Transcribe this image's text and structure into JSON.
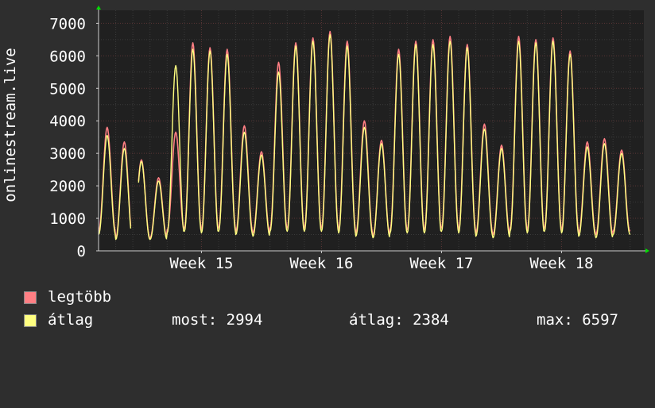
{
  "chart_data": {
    "type": "line",
    "ylabel": "onlinestream.live",
    "ylim": [
      0,
      7400
    ],
    "yticks": [
      0,
      1000,
      2000,
      3000,
      4000,
      5000,
      6000,
      7000
    ],
    "x_unit": "days",
    "xlim": [
      0,
      31.8
    ],
    "xticks": [
      {
        "label": "Week 15",
        "x": 6
      },
      {
        "label": "Week 16",
        "x": 13
      },
      {
        "label": "Week 17",
        "x": 20
      },
      {
        "label": "Week 18",
        "x": 27
      }
    ],
    "series": [
      {
        "name": "legtöbb",
        "color": "#ff7f84",
        "daily_peaks": [
          3800,
          3350,
          2800,
          2250,
          3650,
          6400,
          6250,
          6200,
          3850,
          3050,
          5800,
          6400,
          6550,
          6750,
          6450,
          4000,
          3400,
          6200,
          6450,
          6500,
          6600,
          6350,
          3900,
          3250,
          6600,
          6500,
          6550,
          6150,
          3350,
          3450,
          3100
        ],
        "daily_lows": [
          600,
          400,
          400,
          400,
          650,
          700,
          650,
          700,
          600,
          550,
          700,
          700,
          700,
          700,
          650,
          550,
          450,
          650,
          650,
          650,
          700,
          650,
          550,
          500,
          700,
          650,
          700,
          650,
          550,
          500,
          600
        ]
      },
      {
        "name": "átlag",
        "color": "#ffff80",
        "daily_peaks": [
          3550,
          3150,
          2750,
          2150,
          5700,
          6200,
          6150,
          6050,
          3650,
          2950,
          5500,
          6300,
          6450,
          6650,
          6300,
          3800,
          3300,
          6050,
          6350,
          6350,
          6450,
          6250,
          3750,
          3150,
          6450,
          6400,
          6450,
          6050,
          3200,
          3300,
          3000
        ],
        "daily_lows": [
          500,
          350,
          350,
          350,
          550,
          600,
          550,
          600,
          500,
          450,
          600,
          600,
          600,
          600,
          550,
          450,
          400,
          550,
          550,
          550,
          600,
          550,
          450,
          400,
          600,
          550,
          600,
          550,
          450,
          400,
          500
        ]
      }
    ],
    "gaps": [
      [
        1.9,
        2.3
      ]
    ],
    "grid": true,
    "legend_position": "bottom-left"
  },
  "legend": {
    "items": [
      {
        "label": "legtöbb",
        "color": "#ff7f84"
      },
      {
        "label": "átlag",
        "color": "#ffff80"
      }
    ],
    "stats": {
      "current": "most: 2994",
      "average": "átlag: 2384",
      "max": "max: 6597"
    }
  },
  "colors": {
    "background": "#2e2e2e",
    "plot_background": "#202020",
    "grid_minor": "#3a3a3a",
    "grid_major": "#5a3535",
    "axis": "#cfcfcf",
    "arrow": "#00dd00"
  }
}
